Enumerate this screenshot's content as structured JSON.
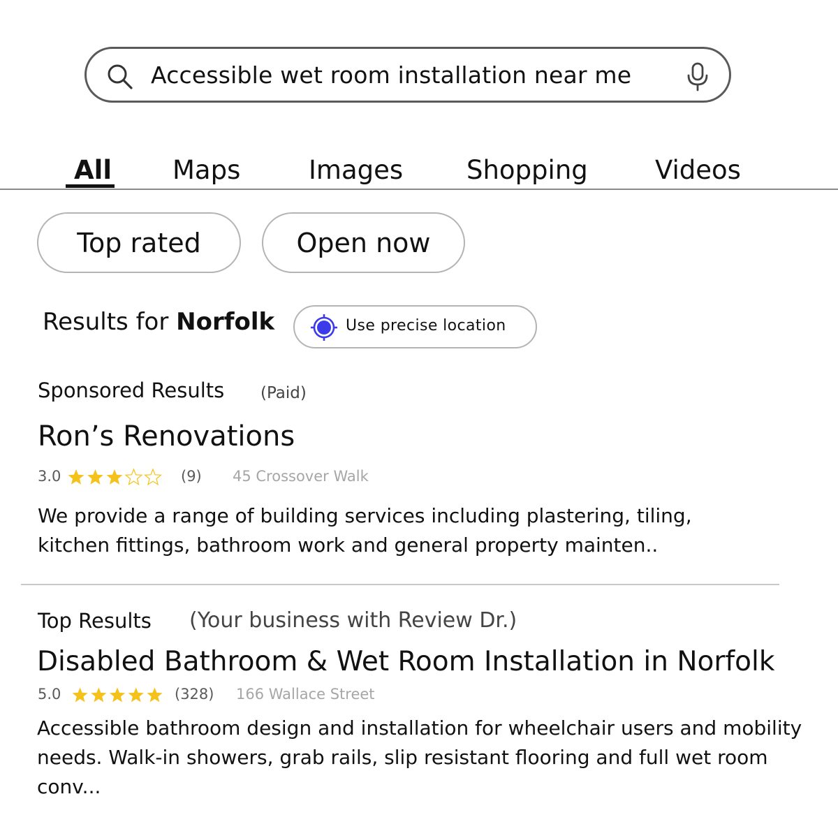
{
  "search": {
    "query": "Accessible wet room installation near me",
    "icon": "search-icon",
    "mic_icon": "mic-icon"
  },
  "tabs": [
    {
      "label": "All",
      "active": true
    },
    {
      "label": "Maps",
      "active": false
    },
    {
      "label": "Images",
      "active": false
    },
    {
      "label": "Shopping",
      "active": false
    },
    {
      "label": "Videos",
      "active": false
    }
  ],
  "filters": [
    {
      "label": "Top rated"
    },
    {
      "label": "Open now"
    }
  ],
  "location": {
    "prefix": "Results for ",
    "place": "Norfolk",
    "precise_button": "Use precise location",
    "accent_color": "#3b3bea"
  },
  "sponsored": {
    "heading": "Sponsored Results",
    "note": "(Paid)",
    "result": {
      "title": "Ron’s Renovations",
      "rating": "3.0",
      "rating_value": 3,
      "review_count": "(9)",
      "address": "45 Crossover Walk",
      "description": "We provide a range of building services including plastering, tiling, kitchen fittings, bathroom work and general property mainten.."
    }
  },
  "top": {
    "heading": "Top Results",
    "note": "(Your business with Review Dr.)",
    "result": {
      "title": "Disabled Bathroom & Wet Room Installation in Norfolk",
      "rating": "5.0",
      "rating_value": 5,
      "review_count": "(328)",
      "address": "166 Wallace Street",
      "description": "Accessible bathroom design and installation for wheelchair users and mobility needs. Walk-in showers, grab rails, slip resistant flooring and full wet room conv..."
    }
  },
  "colors": {
    "star": "#f5c11b",
    "text": "#111111",
    "muted": "#a6a6a6"
  }
}
